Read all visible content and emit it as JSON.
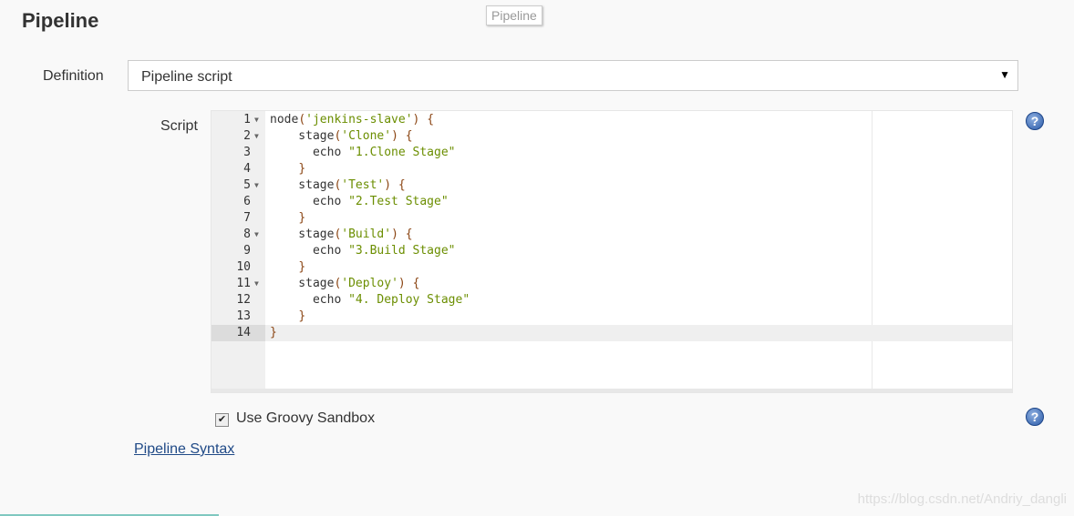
{
  "section_title": "Pipeline",
  "tooltip": "Pipeline",
  "definition": {
    "label": "Definition",
    "value": "Pipeline script"
  },
  "script": {
    "label": "Script",
    "lines": [
      "node('jenkins-slave') {",
      "    stage('Clone') {",
      "      echo \"1.Clone Stage\"",
      "    }",
      "    stage('Test') {",
      "      echo \"2.Test Stage\"",
      "    }",
      "    stage('Build') {",
      "      echo \"3.Build Stage\"",
      "    }",
      "    stage('Deploy') {",
      "      echo \"4. Deploy Stage\"",
      "    }",
      "}"
    ],
    "foldable": [
      1,
      2,
      5,
      8,
      11
    ],
    "active_line": 14
  },
  "sandbox": {
    "label": "Use Groovy Sandbox",
    "checked": true
  },
  "syntax_link": "Pipeline Syntax",
  "watermark": "https://blog.csdn.net/Andriy_dangli"
}
